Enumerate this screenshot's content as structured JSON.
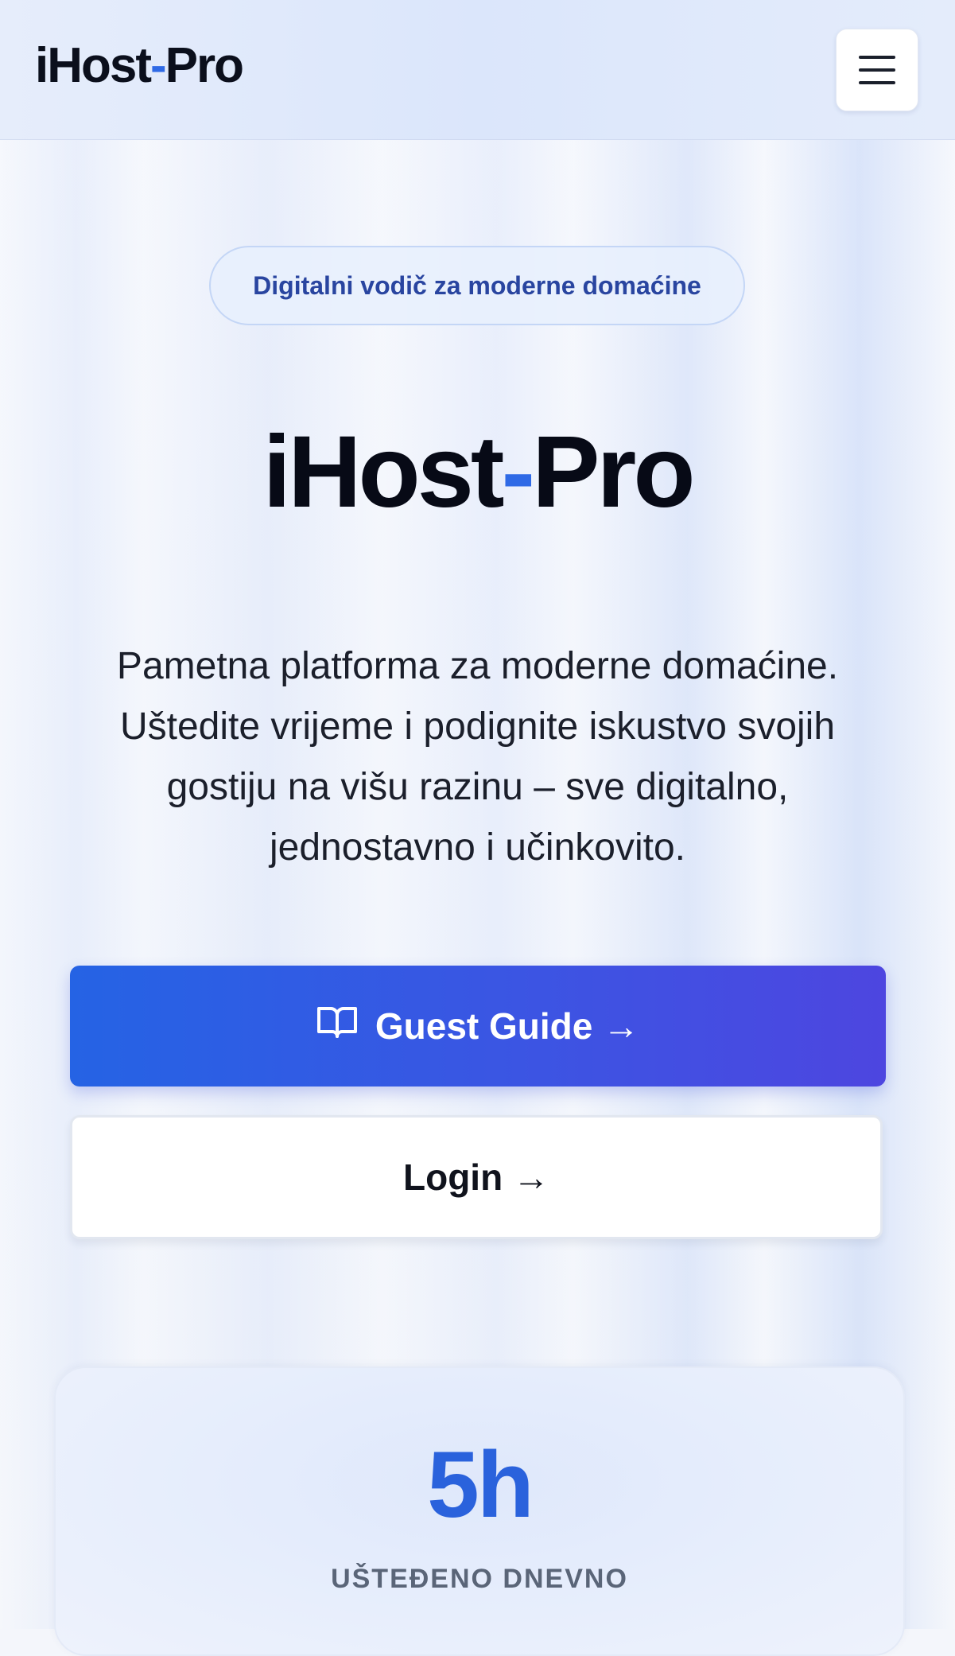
{
  "header": {
    "logo_part1": "iHost",
    "logo_dash": "-",
    "logo_part2": "Pro",
    "menu_icon": "hamburger-menu-icon"
  },
  "hero": {
    "badge": "Digitalni vodič za moderne domaćine",
    "title_part1": "iHost",
    "title_dash": "-",
    "title_part2": "Pro",
    "description": "Pametna platforma za moderne domaćine. Uštedite vrijeme i podignite iskustvo svojih gostiju na višu razinu – sve digitalno, jednostavno i učinkovito."
  },
  "actions": {
    "guest_guide_label": "Guest Guide →",
    "guest_guide_icon": "open-book-icon",
    "login_label": "Login →"
  },
  "stats": {
    "value": "5h",
    "label": "UŠTEĐENO DNEVNO"
  },
  "colors": {
    "accent": "#2f6ae6",
    "primary_gradient_start": "#2563e4",
    "primary_gradient_end": "#4d46e0",
    "stat_value": "#2a62dc"
  }
}
